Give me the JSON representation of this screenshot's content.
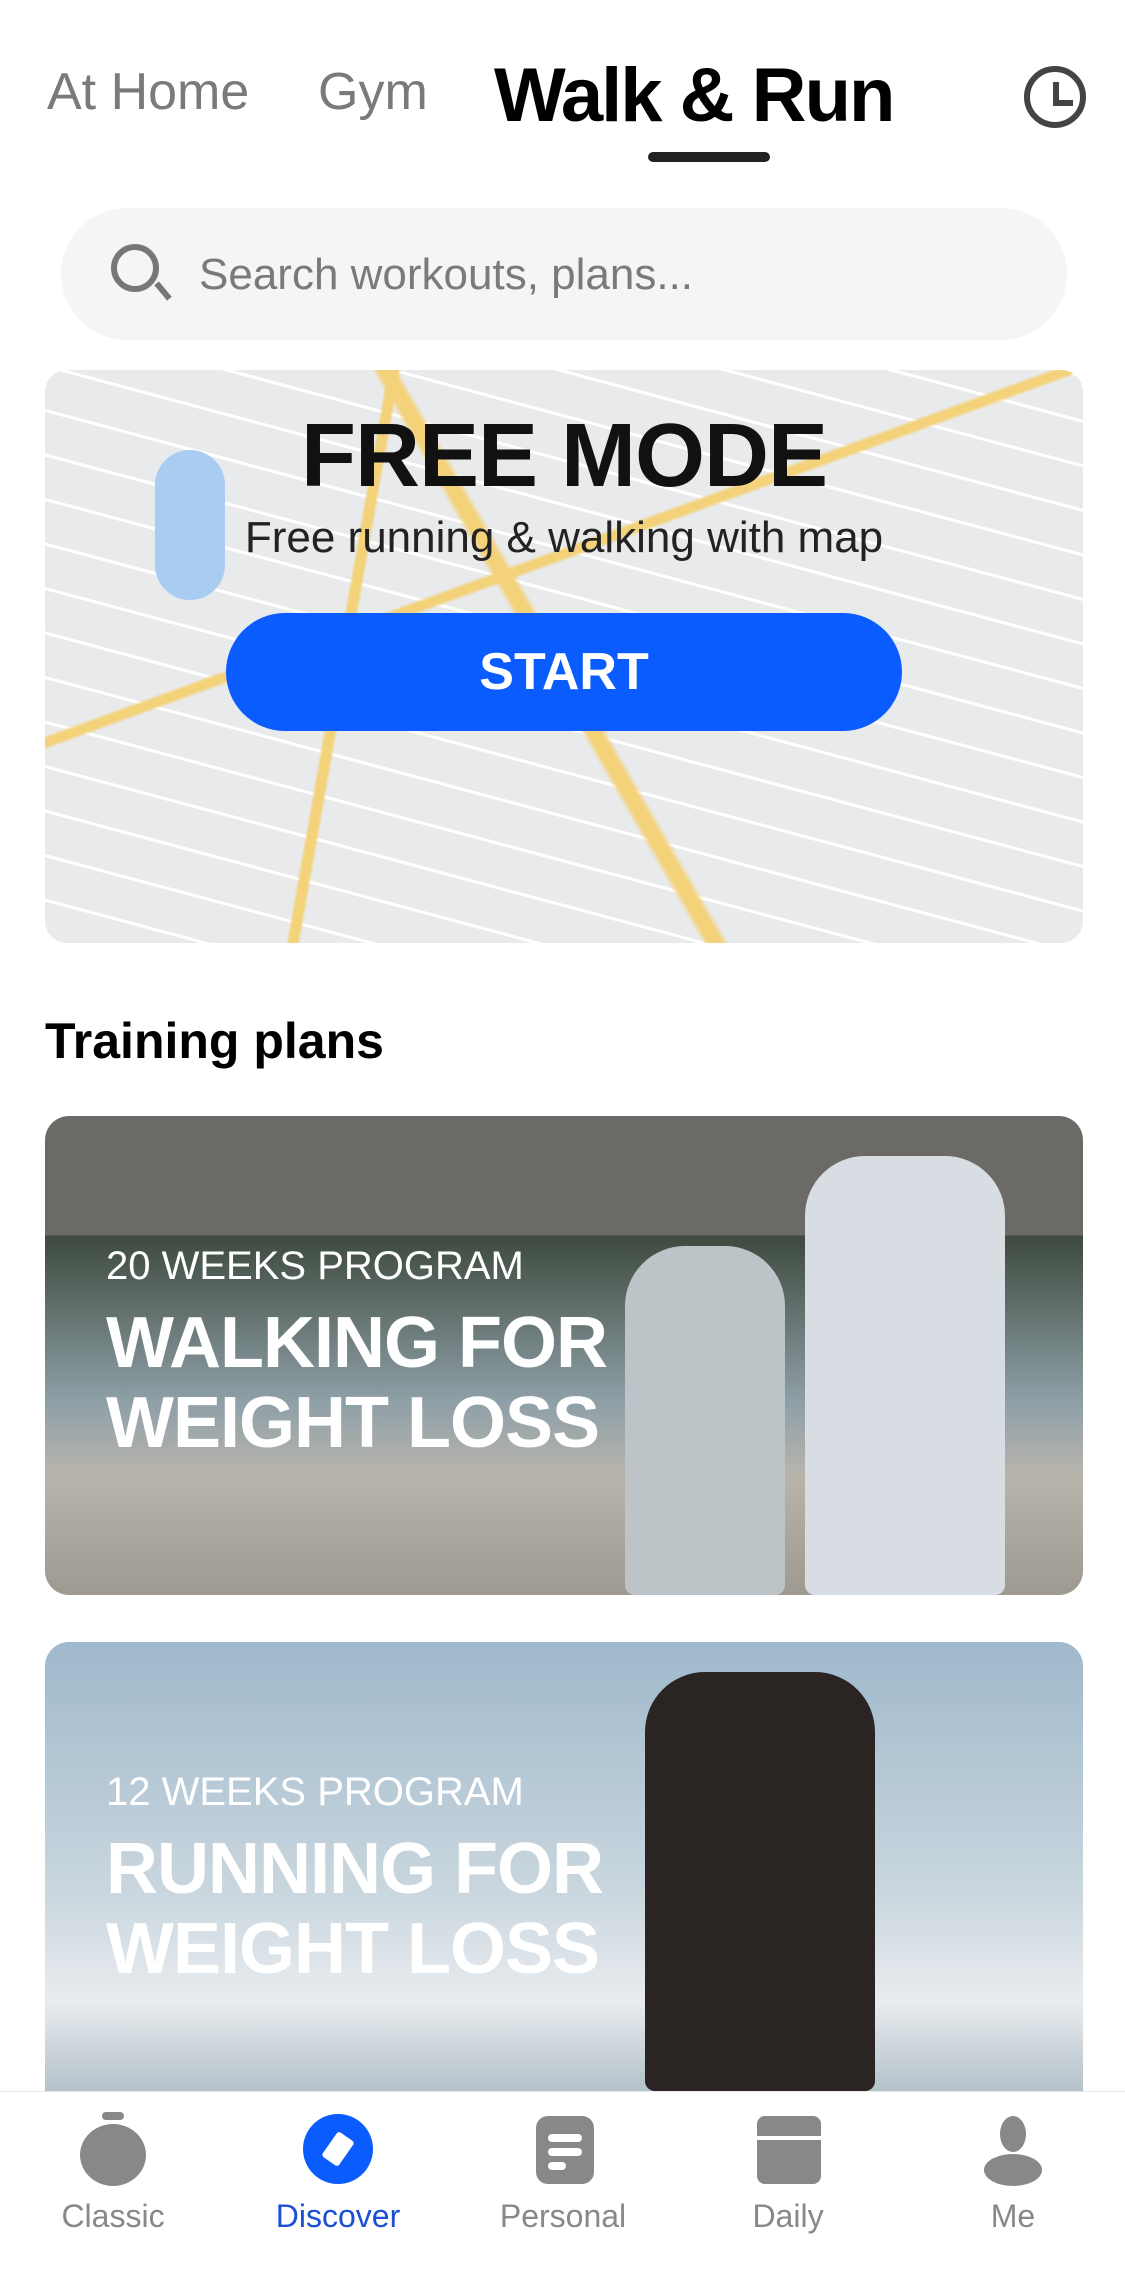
{
  "header": {
    "tabs": [
      {
        "label": "At Home",
        "active": false
      },
      {
        "label": "Gym",
        "active": false
      },
      {
        "label": "Walk & Run",
        "active": true
      }
    ],
    "history_icon": "clock-icon"
  },
  "search": {
    "placeholder": "Search workouts, plans..."
  },
  "free_mode": {
    "title": "FREE MODE",
    "subtitle": "Free running & walking with map",
    "start_label": "START"
  },
  "training_plans": {
    "heading": "Training plans",
    "cards": [
      {
        "kicker": "20 WEEKS PROGRAM",
        "title_line1": "WALKING FOR",
        "title_line2": "WEIGHT LOSS"
      },
      {
        "kicker": "12 WEEKS PROGRAM",
        "title_line1": "RUNNING FOR",
        "title_line2": "WEIGHT LOSS"
      }
    ]
  },
  "bottom_nav": {
    "accent": "#0a5cff",
    "items": [
      {
        "label": "Classic",
        "icon": "stopwatch-icon"
      },
      {
        "label": "Discover",
        "icon": "compass-icon",
        "active": true
      },
      {
        "label": "Personal",
        "icon": "list-icon"
      },
      {
        "label": "Daily",
        "icon": "calendar-icon"
      },
      {
        "label": "Me",
        "icon": "person-icon"
      }
    ]
  }
}
